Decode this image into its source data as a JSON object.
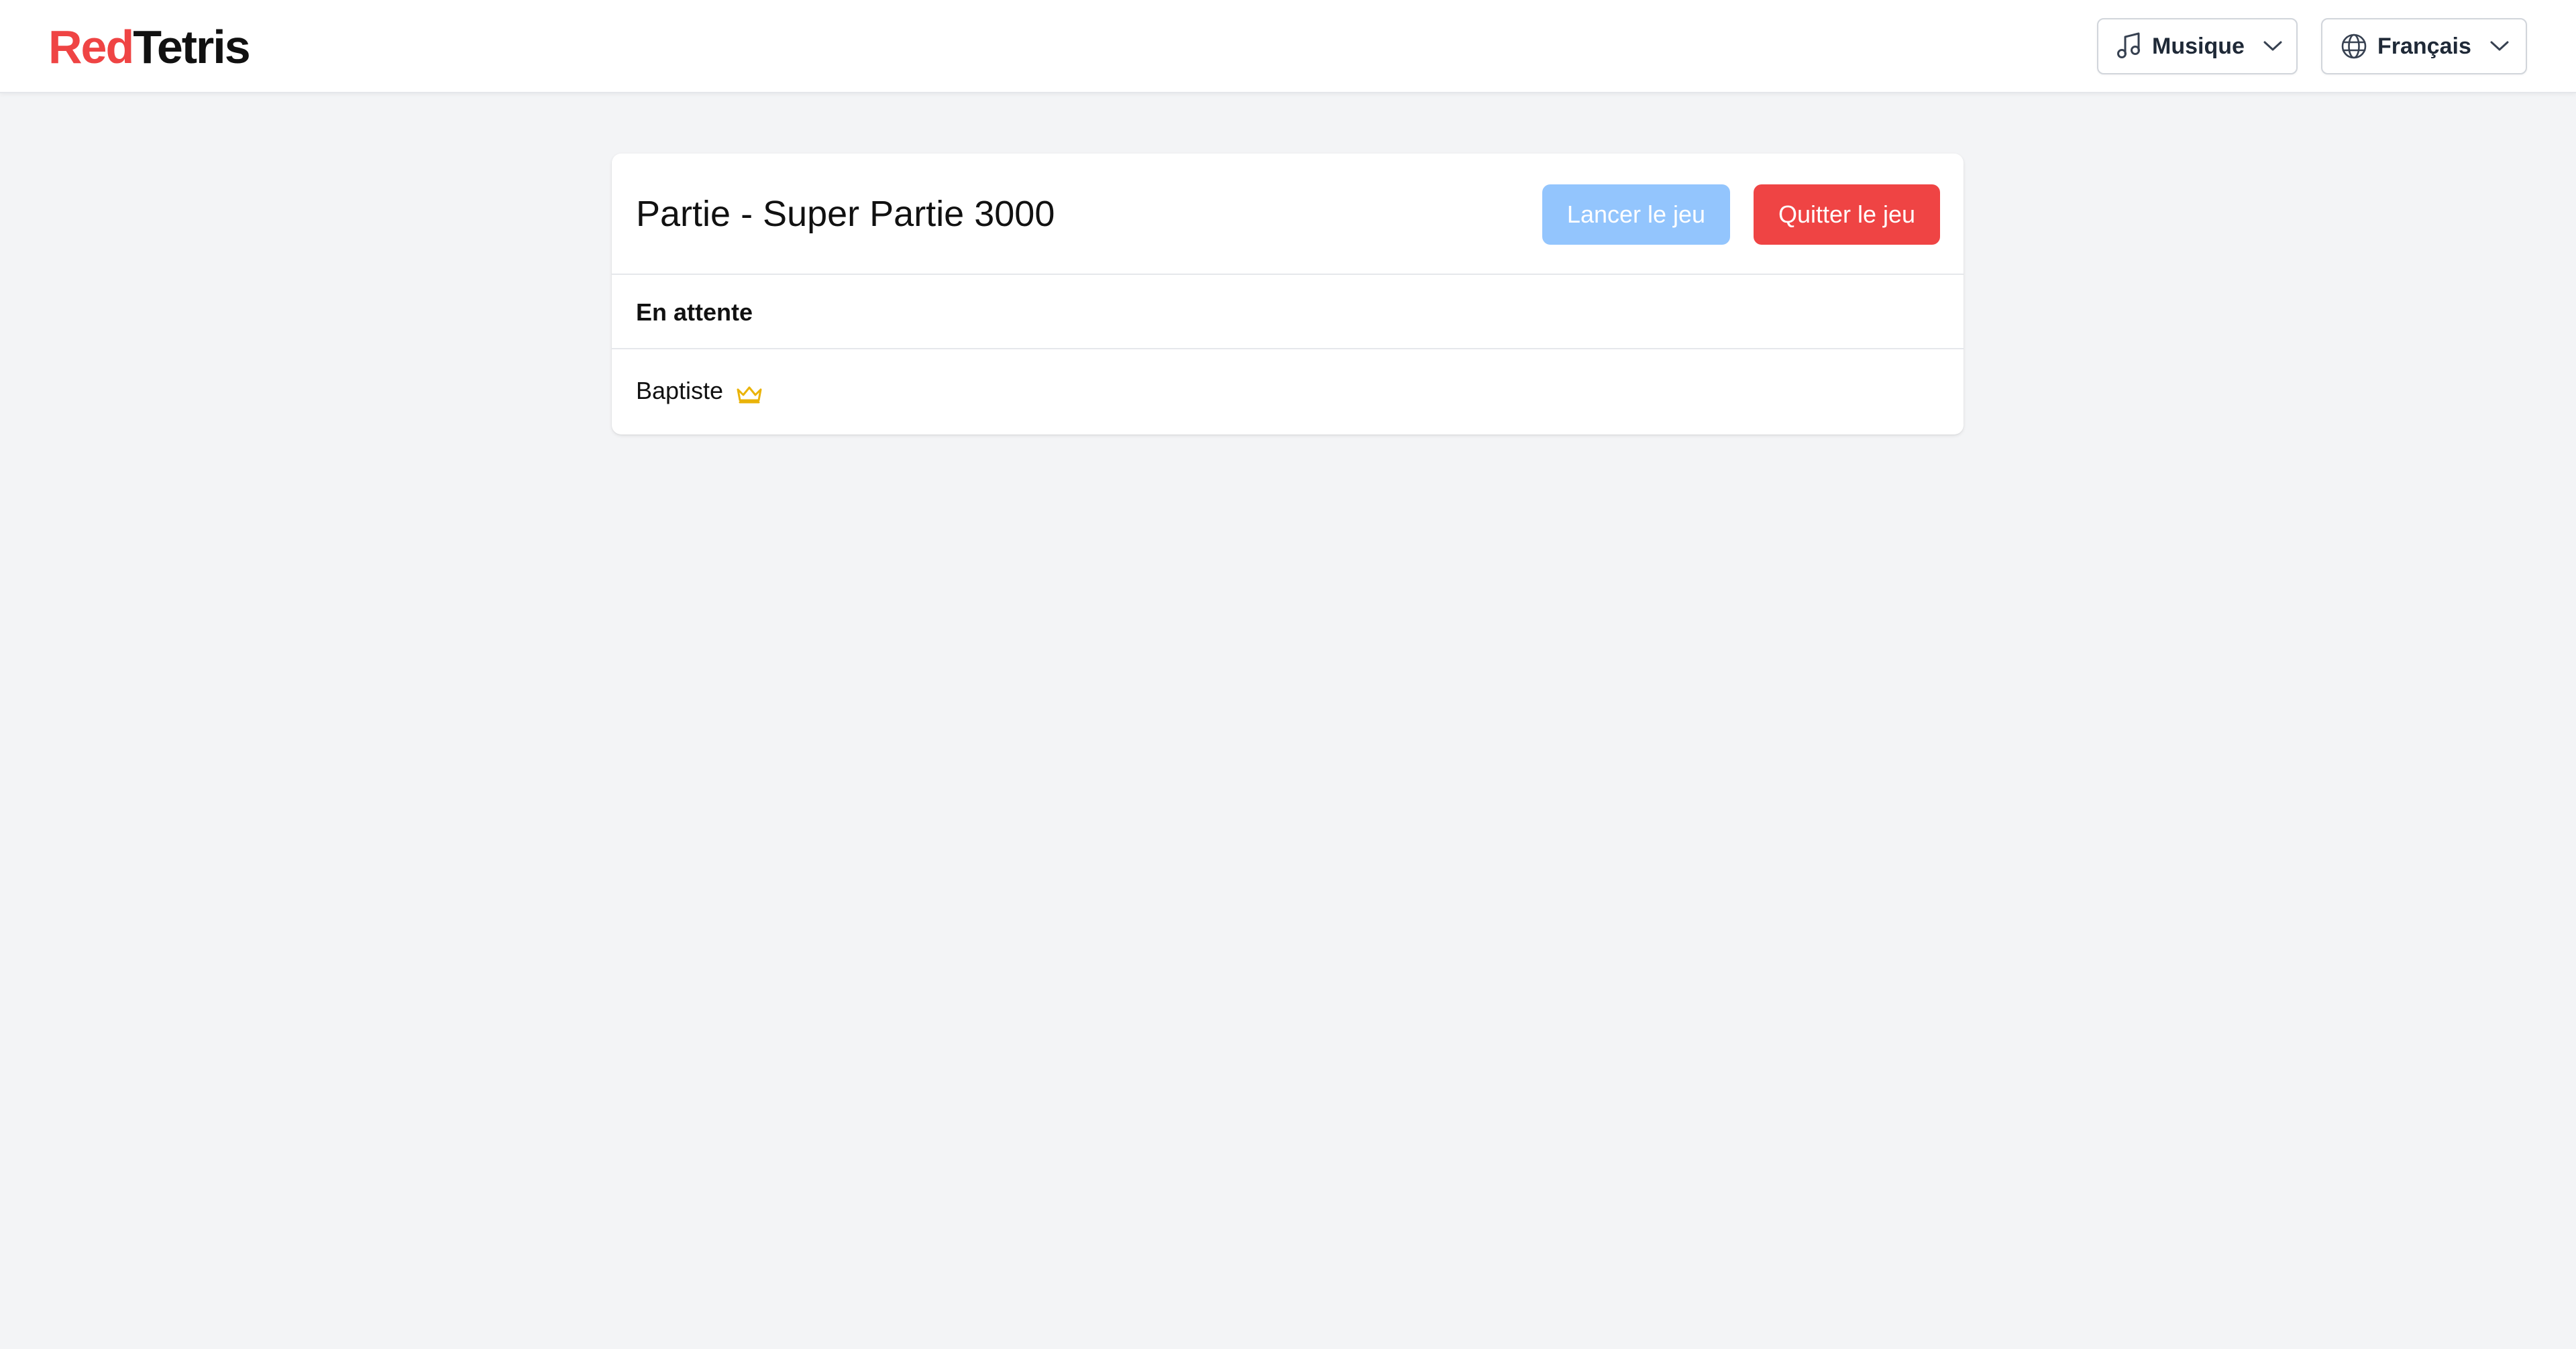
{
  "header": {
    "logo_part1": "Red",
    "logo_part2": "Tetris",
    "music": {
      "label": "Musique",
      "icon": "music-note-icon"
    },
    "language": {
      "label": "Français",
      "icon": "globe-icon"
    }
  },
  "game": {
    "title": "Partie - Super Partie 3000",
    "launch_label": "Lancer le jeu",
    "quit_label": "Quitter le jeu",
    "status_label": "En attente",
    "players": [
      {
        "name": "Baptiste",
        "is_host": true,
        "badge_icon": "crown-icon"
      }
    ]
  },
  "colors": {
    "brand_red": "#ef4444",
    "launch_disabled": "#93c5fd",
    "crown": "#eab308",
    "background": "#f3f4f6"
  }
}
